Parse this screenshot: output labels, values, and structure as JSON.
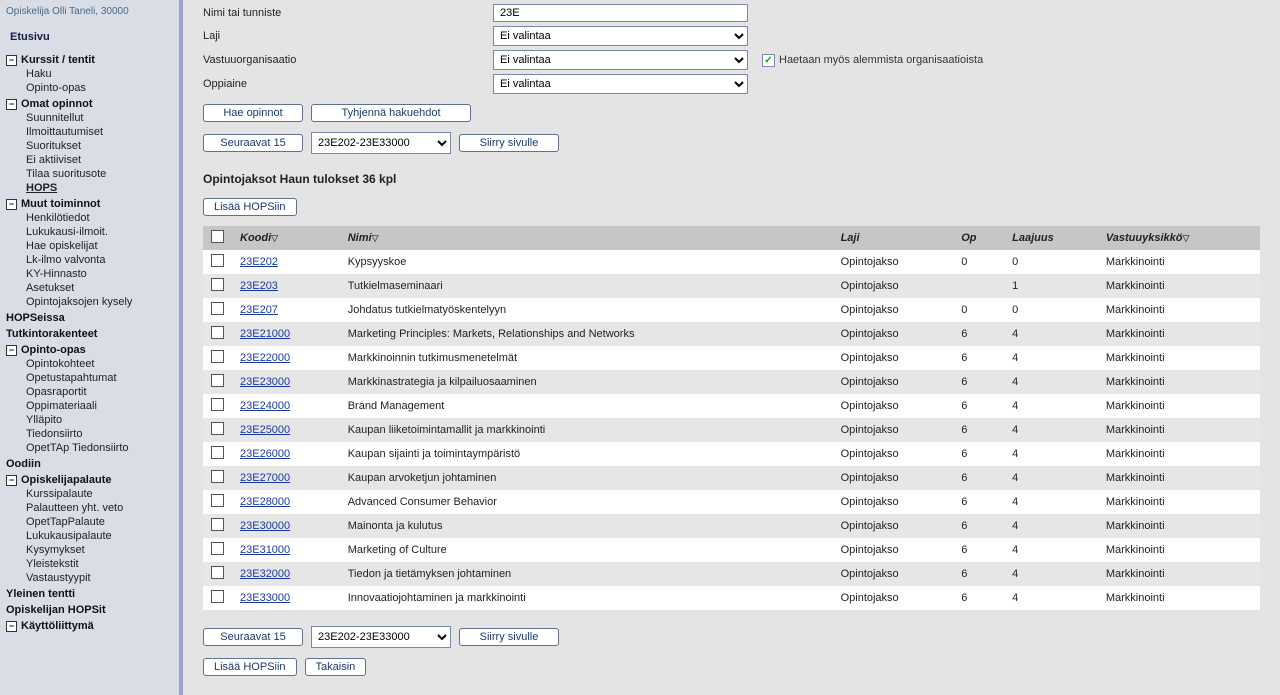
{
  "user": "Opiskelija Olli Taneli, 30000",
  "home": "Etusivu",
  "nav": [
    {
      "head": "Kurssit / tentit",
      "collapsible": true,
      "items": [
        "Haku",
        "Opinto-opas"
      ]
    },
    {
      "head": "Omat opinnot",
      "collapsible": true,
      "items": [
        "Suunnitellut",
        "Ilmoittautumiset",
        "Suoritukset",
        "Ei aktiiviset",
        "Tilaa suoritusote",
        {
          "label": "HOPS",
          "u": true
        }
      ]
    },
    {
      "head": "Muut toiminnot",
      "collapsible": true,
      "items": [
        "Henkilötiedot",
        "Lukukausi-ilmoit.",
        "Hae opiskelijat",
        "Lk-ilmo valvonta",
        "KY-Hinnasto",
        "Asetukset",
        "Opintojaksojen kysely"
      ]
    },
    {
      "head": "HOPSeissa",
      "collapsible": false,
      "items": []
    },
    {
      "head": "Tutkintorakenteet",
      "collapsible": false,
      "items": []
    },
    {
      "head": "Opinto-opas",
      "collapsible": true,
      "items": [
        "Opintokohteet",
        "Opetustapahtumat",
        "Opasraportit",
        "Oppimateriaali",
        "Ylläpito",
        "Tiedonsiirto",
        "OpetTAp Tiedonsiirto"
      ]
    },
    {
      "head": "Oodiin",
      "collapsible": false,
      "items": []
    },
    {
      "head": "Opiskelijapalaute",
      "collapsible": true,
      "items": [
        "Kurssipalaute",
        "Palautteen yht. veto",
        "OpetTapPalaute",
        "Lukukausipalaute",
        "Kysymykset",
        "Yleistekstit",
        "Vastaustyypit"
      ]
    },
    {
      "head": "Yleinen tentti",
      "collapsible": false,
      "items": []
    },
    {
      "head": "Opiskelijan HOPSit",
      "collapsible": false,
      "items": []
    },
    {
      "head": "Käyttöliittymä",
      "collapsible": true,
      "items": []
    }
  ],
  "form": {
    "name_label": "Nimi tai tunniste",
    "name_value": "23E",
    "type_label": "Laji",
    "type_value": "Ei valintaa",
    "org_label": "Vastuuorganisaatio",
    "org_value": "Ei valintaa",
    "subject_label": "Oppiaine",
    "subject_value": "Ei valintaa",
    "sub_org_label": "Haetaan myös alemmista organisaatioista",
    "search_btn": "Hae opinnot",
    "clear_btn": "Tyhjennä hakuehdot",
    "next_btn": "Seuraavat 15",
    "page_select": "23E202-23E33000",
    "goto_btn": "Siirry sivulle",
    "add_btn": "Lisää HOPSiin",
    "back_btn": "Takaisin"
  },
  "results_title": "Opintojaksot Haun tulokset 36 kpl",
  "headers": {
    "code": "Koodi",
    "name": "Nimi",
    "type": "Laji",
    "op": "Op",
    "scope": "Laajuus",
    "unit": "Vastuuyksikkö"
  },
  "rows": [
    {
      "code": "23E202",
      "name": "Kypsyyskoe",
      "type": "Opintojakso",
      "op": "0",
      "scope": "0",
      "unit": "Markkinointi"
    },
    {
      "code": "23E203",
      "name": "Tutkielmaseminaari",
      "type": "Opintojakso",
      "op": "",
      "scope": "1",
      "unit": "Markkinointi"
    },
    {
      "code": "23E207",
      "name": "Johdatus tutkielmatyöskentelyyn",
      "type": "Opintojakso",
      "op": "0",
      "scope": "0",
      "unit": "Markkinointi"
    },
    {
      "code": "23E21000",
      "name": "Marketing Principles: Markets, Relationships and Networks",
      "type": "Opintojakso",
      "op": "6",
      "scope": "4",
      "unit": "Markkinointi"
    },
    {
      "code": "23E22000",
      "name": "Markkinoinnin tutkimusmenetelmät",
      "type": "Opintojakso",
      "op": "6",
      "scope": "4",
      "unit": "Markkinointi"
    },
    {
      "code": "23E23000",
      "name": "Markkinastrategia ja kilpailuosaaminen",
      "type": "Opintojakso",
      "op": "6",
      "scope": "4",
      "unit": "Markkinointi"
    },
    {
      "code": "23E24000",
      "name": "Brand Management",
      "type": "Opintojakso",
      "op": "6",
      "scope": "4",
      "unit": "Markkinointi"
    },
    {
      "code": "23E25000",
      "name": "Kaupan liiketoimintamallit ja markkinointi",
      "type": "Opintojakso",
      "op": "6",
      "scope": "4",
      "unit": "Markkinointi"
    },
    {
      "code": "23E26000",
      "name": "Kaupan sijainti ja toimintaympäristö",
      "type": "Opintojakso",
      "op": "6",
      "scope": "4",
      "unit": "Markkinointi"
    },
    {
      "code": "23E27000",
      "name": "Kaupan arvoketjun johtaminen",
      "type": "Opintojakso",
      "op": "6",
      "scope": "4",
      "unit": "Markkinointi"
    },
    {
      "code": "23E28000",
      "name": "Advanced Consumer Behavior",
      "type": "Opintojakso",
      "op": "6",
      "scope": "4",
      "unit": "Markkinointi"
    },
    {
      "code": "23E30000",
      "name": "Mainonta ja kulutus",
      "type": "Opintojakso",
      "op": "6",
      "scope": "4",
      "unit": "Markkinointi"
    },
    {
      "code": "23E31000",
      "name": "Marketing of Culture",
      "type": "Opintojakso",
      "op": "6",
      "scope": "4",
      "unit": "Markkinointi"
    },
    {
      "code": "23E32000",
      "name": "Tiedon ja tietämyksen johtaminen",
      "type": "Opintojakso",
      "op": "6",
      "scope": "4",
      "unit": "Markkinointi"
    },
    {
      "code": "23E33000",
      "name": "Innovaatiojohtaminen ja markkinointi",
      "type": "Opintojakso",
      "op": "6",
      "scope": "4",
      "unit": "Markkinointi"
    }
  ]
}
